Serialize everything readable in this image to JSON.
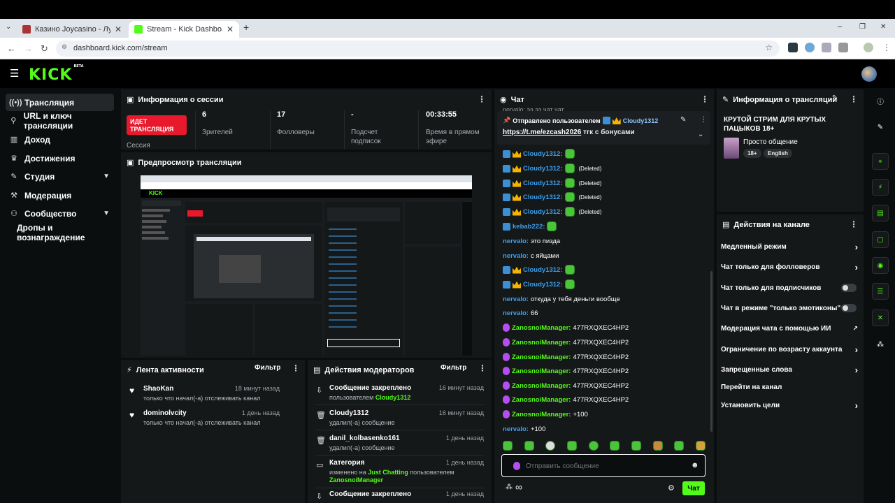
{
  "browser": {
    "tabs": [
      {
        "title": "Казино Joycasino - Лучшие онл...",
        "active": false
      },
      {
        "title": "Stream - Kick Dashboard",
        "active": true
      }
    ],
    "url": "dashboard.kick.com/stream",
    "new_tab_icon": "+",
    "window_controls": [
      "–",
      "❐",
      "✕"
    ]
  },
  "app": {
    "logo": "KICK",
    "logo_tag": "BETA"
  },
  "sidebar": {
    "items": [
      {
        "label": "Трансляция",
        "icon": "broadcast-icon",
        "active": true
      },
      {
        "label": "URL и ключ трансляции",
        "icon": "key-icon"
      },
      {
        "label": "Доход",
        "icon": "chart-icon"
      },
      {
        "label": "Достижения",
        "icon": "trophy-icon"
      },
      {
        "label": "Студия",
        "icon": "wand-icon",
        "chevron": true
      },
      {
        "label": "Модерация",
        "icon": "hammer-icon"
      },
      {
        "label": "Сообщество",
        "icon": "users-icon",
        "chevron": true
      },
      {
        "label": "Дропы и вознаграждение",
        "icon": ""
      }
    ]
  },
  "session": {
    "title": "Информация о сессии",
    "live_badge": "ИДЕТ ТРАНСЛЯЦИЯ",
    "session_label": "Сессия",
    "stats": [
      {
        "value": "6",
        "label": "Зрителей"
      },
      {
        "value": "17",
        "label": "Фолловеры"
      },
      {
        "value": "-",
        "label": "Подсчет подписок"
      },
      {
        "value": "00:33:55",
        "label": "Время в прямом эфире"
      }
    ]
  },
  "preview": {
    "title": "Предпросмотр трансляции"
  },
  "activity": {
    "title": "Лента активности",
    "filter": "Фильтр",
    "events": [
      {
        "name": "ShaoKan",
        "text": "только что начал(-а) отслеживать канал",
        "time": "18 минут назад"
      },
      {
        "name": "dominolvcity",
        "text": "только что начал(-а) отслеживать канал",
        "time": "1 день назад"
      }
    ]
  },
  "modactions": {
    "title": "Действия модераторов",
    "filter": "Фильтр",
    "events": [
      {
        "name": "Сообщение закреплено",
        "text": "пользователем ",
        "highlight": "Cloudy1312",
        "time": "16 минут назад",
        "icon": "pin-icon"
      },
      {
        "name": "Cloudy1312",
        "text": "удалил(-а) сообщение",
        "highlight": "",
        "time": "16 минут назад",
        "icon": "trash-icon"
      },
      {
        "name": "danil_kolbasenko161",
        "text": "удалил(-а) сообщение",
        "highlight": "",
        "time": "1 день назад",
        "icon": "trash-icon"
      },
      {
        "name": "Категория",
        "text": "изменено на ",
        "highlight": "Just Chatting",
        "text2": " пользователем",
        "highlight2": "ZanosnoiManager",
        "time": "1 день назад",
        "icon": "category-icon"
      },
      {
        "name": "Сообщение закреплено",
        "text": "",
        "highlight": "",
        "time": "1 день назад",
        "icon": "pin-icon"
      }
    ]
  },
  "chat": {
    "title": "Чат",
    "cut_line": "nervalo: ээ ээ чат чат",
    "pinned": {
      "prefix": "Отправлено пользователем",
      "user": "Cloudy1312",
      "link": "https://t.me/ezcash2026",
      "text": "тгк с бонусами"
    },
    "messages": [
      {
        "user": "Cloudy1312",
        "badges": [
          "blue",
          "gold"
        ],
        "emote": true,
        "deleted": ""
      },
      {
        "user": "Cloudy1312",
        "badges": [
          "blue",
          "gold"
        ],
        "emote": true,
        "deleted": "(Deleted)"
      },
      {
        "user": "Cloudy1312",
        "badges": [
          "blue",
          "gold"
        ],
        "emote": true,
        "deleted": "(Deleted)"
      },
      {
        "user": "Cloudy1312",
        "badges": [
          "blue",
          "gold"
        ],
        "emote": true,
        "deleted": "(Deleted)"
      },
      {
        "user": "Cloudy1312",
        "badges": [
          "blue",
          "gold"
        ],
        "emote": true,
        "deleted": "(Deleted)"
      },
      {
        "user": "kebab222",
        "badges": [
          "blue"
        ],
        "emote": true,
        "deleted": ""
      },
      {
        "user": "nervalo",
        "badges": [],
        "text": "это пизда"
      },
      {
        "user": "nervalo",
        "badges": [],
        "text": "с яйцами"
      },
      {
        "user": "Cloudy1312",
        "badges": [
          "blue",
          "gold"
        ],
        "emote": true
      },
      {
        "user": "Cloudy1312",
        "badges": [
          "blue",
          "gold"
        ],
        "emote": true
      },
      {
        "user": "nervalo",
        "badges": [],
        "text": "откуда у тебя деньги вообще"
      },
      {
        "user": "nervalo",
        "badges": [],
        "text": "66"
      },
      {
        "user": "ZanosnoiManager",
        "badges": [
          "mic"
        ],
        "text": "477RXQXEC4HP2"
      },
      {
        "user": "ZanosnoiManager",
        "badges": [
          "mic"
        ],
        "text": "477RXQXEC4HP2"
      },
      {
        "user": "ZanosnoiManager",
        "badges": [
          "mic"
        ],
        "text": "477RXQXEC4HP2"
      },
      {
        "user": "ZanosnoiManager",
        "badges": [
          "mic"
        ],
        "text": "477RXQXEC4HP2"
      },
      {
        "user": "ZanosnoiManager",
        "badges": [
          "mic"
        ],
        "text": "477RXQXEC4HP2"
      },
      {
        "user": "ZanosnoiManager",
        "badges": [
          "mic"
        ],
        "text": "477RXQXEC4HP2"
      },
      {
        "user": "ZanosnoiManager",
        "badges": [
          "mic"
        ],
        "text": "+100"
      },
      {
        "user": "nervalo",
        "badges": [],
        "text": "+100"
      }
    ],
    "input_placeholder": "Отправить сообщение",
    "send_button": "Чат",
    "infinity": "∞"
  },
  "stream_info": {
    "title": "Информация о трансляции",
    "stream_title": "КРУТОЙ СТРИМ ДЛЯ КРУТЫХ ПАЦЫКОВ 18+",
    "category": "Просто общение",
    "tags": [
      "18+",
      "English"
    ]
  },
  "channel_actions": {
    "title": "Действия на канале",
    "items": [
      {
        "label": "Медленный режим",
        "control": "chevron"
      },
      {
        "label": "Чат только для фолловеров",
        "control": "chevron"
      },
      {
        "label": "Чат только для подписчиков",
        "control": "toggle"
      },
      {
        "label": "Чат в режиме \"только эмотиконы\"",
        "control": "toggle"
      },
      {
        "label": "Модерация чата с помощью ИИ",
        "control": "external"
      },
      {
        "label": "Ограничение по возрасту аккаунта",
        "control": "chevron"
      },
      {
        "label": "Запрещенные слова",
        "control": "chevron"
      },
      {
        "label": "Перейти на канал",
        "control": "none"
      },
      {
        "label": "Установить цели",
        "control": "chevron"
      }
    ]
  },
  "colors": {
    "accent": "#53fc18",
    "live": "#e8192c",
    "panel": "#151819",
    "bg": "#0b0e0f"
  }
}
